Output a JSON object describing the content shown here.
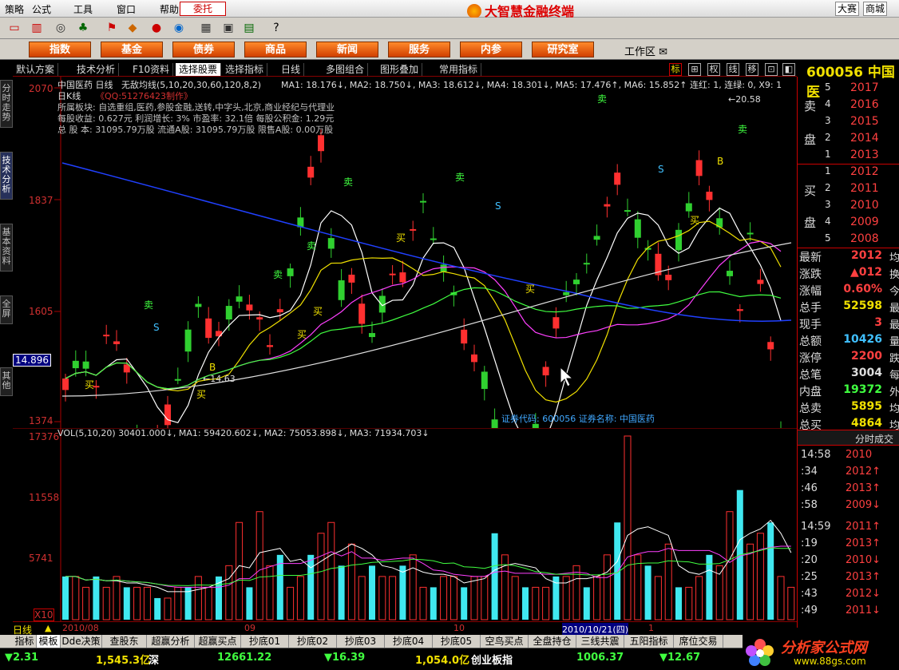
{
  "menubar": {
    "items": [
      "策略",
      "公式",
      "工具",
      "窗口",
      "帮助"
    ],
    "trade_btn": "委托",
    "app_title": "大智慧金融终端",
    "right_btns": [
      "大赛",
      "商城"
    ]
  },
  "nav": {
    "buttons": [
      "指数",
      "基金",
      "债券",
      "商品",
      "新闻",
      "服务",
      "内参",
      "研究室"
    ],
    "workarea": "工作区"
  },
  "left_tabs": [
    "分时走势",
    "技术分析",
    "基本资料",
    "全屏",
    "其他"
  ],
  "chart_toolbar": {
    "items": [
      "默认方案",
      "技术分析",
      "F10资料",
      "选择股票",
      "选择指标",
      "日线",
      "多图组合",
      "图形叠加",
      "常用指标"
    ],
    "right_icons": [
      "标",
      "⊞",
      "权",
      "线",
      "移",
      "⊡",
      "◧"
    ]
  },
  "stock": {
    "code": "600056",
    "name": "中国医"
  },
  "main_chart": {
    "title": "中国医药 日线",
    "qq": "《QQ:51276423制作》",
    "indicator": "无敌均线(5,10,20,30,60,120,8,2)",
    "ma_line": "MA1: 18.176↓, MA2: 18.750↓, MA3: 18.612↓, MA4: 18.301↓, MA5: 17.476↑, MA6: 15.852↑ 连红: 1, 连绿: 0, X9: 1",
    "period_label": "日K线",
    "info1": "所属板块: 自选重组,医药,参股金融,送转,中字头,北京,商业经纪与代理业",
    "info2": "每股收益: 0.627元   利润增长: 3%   市盈率: 32.1倍   每股公积金: 1.29元",
    "info3": "总 股 本: 31095.79万股  流通A股: 31095.79万股  限售A股: 0.00万股",
    "y_labels": [
      "2070",
      "1837",
      "1605",
      "1374"
    ],
    "cursor_price": "14.896",
    "high_note": "←20.58",
    "low_note": "←14.63",
    "footer": "证券代码: 600056  证券名称: 中国医药",
    "buy_label": "买",
    "sell_label": "卖",
    "b_label": "B",
    "s_label": "S"
  },
  "vol_chart": {
    "header": "VOL(5,10,20)  30401.000↓, MA1: 59420.602↓, MA2: 75053.898↓, MA3: 71934.703↓",
    "y_labels": [
      "17376",
      "11558",
      "5741"
    ],
    "unit": "X10"
  },
  "date_bar": {
    "period": "日线",
    "dates": [
      "2010/08",
      "09",
      "10",
      "2010/10/21(四)",
      "1"
    ]
  },
  "orderbook": {
    "sell_label": [
      "卖",
      "盘"
    ],
    "buy_label": [
      "买",
      "盘"
    ],
    "sells": [
      {
        "level": "5",
        "price": "2017"
      },
      {
        "level": "4",
        "price": "2016"
      },
      {
        "level": "3",
        "price": "2015"
      },
      {
        "level": "2",
        "price": "2014"
      },
      {
        "level": "1",
        "price": "2013"
      }
    ],
    "buys": [
      {
        "level": "1",
        "price": "2012"
      },
      {
        "level": "2",
        "price": "2011"
      },
      {
        "level": "3",
        "price": "2010"
      },
      {
        "level": "4",
        "price": "2009"
      },
      {
        "level": "5",
        "price": "2008"
      }
    ]
  },
  "quote": [
    {
      "label": "最新",
      "value": "2012",
      "extra": "均",
      "color": "#ff4040"
    },
    {
      "label": "涨跌",
      "value": "▲012",
      "extra": "换",
      "color": "#ff4040"
    },
    {
      "label": "涨幅",
      "value": "0.60%",
      "extra": "今",
      "color": "#ff4040"
    },
    {
      "label": "总手",
      "value": "52598",
      "extra": "最",
      "color": "#f0e000"
    },
    {
      "label": "现手",
      "value": "3",
      "extra": "最",
      "color": "#ff4040"
    },
    {
      "label": "总额",
      "value": "10426",
      "extra": "量",
      "color": "#40c0ff"
    },
    {
      "label": "涨停",
      "value": "2200",
      "extra": "跌",
      "color": "#ff4040"
    },
    {
      "label": "总笔",
      "value": "3004",
      "extra": "每",
      "color": "#dddddd"
    },
    {
      "label": "内盘",
      "value": "19372",
      "extra": "外",
      "color": "#40ff40"
    },
    {
      "label": "总卖",
      "value": "5895",
      "extra": "均",
      "color": "#f0e000"
    },
    {
      "label": "总买",
      "value": "4864",
      "extra": "均",
      "color": "#f0e000"
    }
  ],
  "ticks": {
    "header": "分时成交",
    "rows": [
      {
        "time": "14:58",
        "price": "2010"
      },
      {
        "time": ":34",
        "price": "2012↑"
      },
      {
        "time": ":46",
        "price": "2013↑"
      },
      {
        "time": ":58",
        "price": "2009↓"
      },
      {
        "time": "14:59",
        "price": "2011↑"
      },
      {
        "time": ":19",
        "price": "2013↑"
      },
      {
        "time": ":20",
        "price": "2010↓"
      },
      {
        "time": ":25",
        "price": "2013↑"
      },
      {
        "time": ":43",
        "price": "2012↓"
      },
      {
        "time": ":49",
        "price": "2011↓"
      }
    ]
  },
  "bottom_tabs": [
    "指标",
    "模板",
    "Dde决策",
    "查股东",
    "超赢分析",
    "超赢买点",
    "抄底01",
    "抄底02",
    "抄底03",
    "抄底04",
    "抄底05",
    "空鸟买点",
    "全盘持仓",
    "三线共震",
    "五阳指标",
    "席位交易"
  ],
  "status": [
    {
      "text": "▼2.31",
      "color": "#40ff40"
    },
    {
      "text": "1,545.3亿",
      "color": "#f0e000"
    },
    {
      "text": "深",
      "color": "#ffffff"
    },
    {
      "text": "12661.22",
      "color": "#40ff40"
    },
    {
      "text": "▼16.39",
      "color": "#40ff40"
    },
    {
      "text": "1,054.0亿",
      "color": "#f0e000"
    },
    {
      "text": "创业板指",
      "color": "#ffffff"
    },
    {
      "text": "1006.37",
      "color": "#40ff40"
    },
    {
      "text": "▼12.67",
      "color": "#40ff40"
    }
  ],
  "brand": {
    "name": "分析家公式网",
    "url": "www.88gs.com"
  },
  "colors": {
    "up": "#ff3030",
    "down": "#30d030",
    "vol_down": "#40e8f0",
    "bg": "#000000"
  }
}
